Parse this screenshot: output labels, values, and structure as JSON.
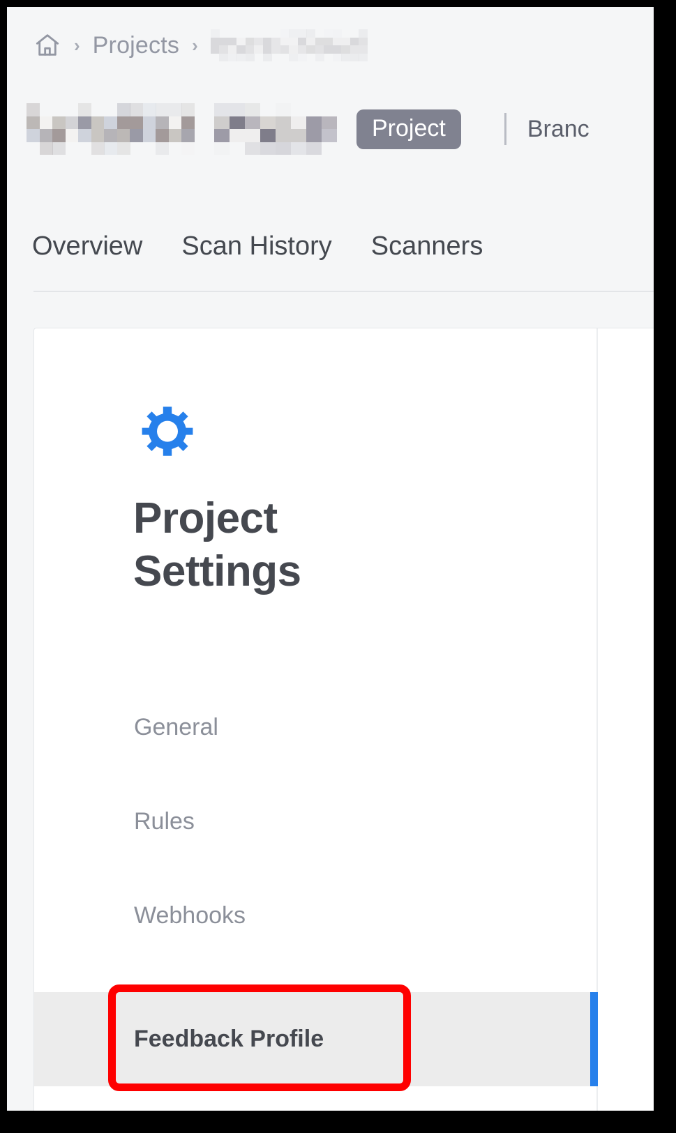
{
  "breadcrumb": {
    "home_icon": "home-icon",
    "separator": "›",
    "items": [
      {
        "label": "Projects",
        "redacted": false
      },
      {
        "label": "",
        "redacted": true
      }
    ]
  },
  "org_row": {
    "org_redacted": true,
    "team_redacted": true,
    "scope_pill": "Project",
    "divider": "|",
    "branches_label": "Branc"
  },
  "tabs": [
    {
      "label": "Overview",
      "active": false
    },
    {
      "label": "Scan History",
      "active": false
    },
    {
      "label": "Scanners",
      "active": false
    }
  ],
  "settings_panel": {
    "gear_icon": "gear-icon",
    "title": "Project Settings",
    "title_line_1": "Project",
    "title_line_2": "Settings",
    "nav_items": [
      {
        "label": "General",
        "active": false
      },
      {
        "label": "Rules",
        "active": false
      },
      {
        "label": "Webhooks",
        "active": false
      },
      {
        "label": "Feedback Profile",
        "active": true
      }
    ]
  },
  "annotation": {
    "target": "Feedback Profile",
    "shape": "rounded-rectangle",
    "color": "#fe0000"
  },
  "colors": {
    "accent_blue": "#2680eb",
    "page_background": "#f5f6f7",
    "card_background": "#ffffff",
    "active_row_background": "#ececec",
    "pill_background": "#808290",
    "text_primary": "#45484f",
    "text_muted": "#8b8f99",
    "annotation_red": "#fe0000"
  }
}
